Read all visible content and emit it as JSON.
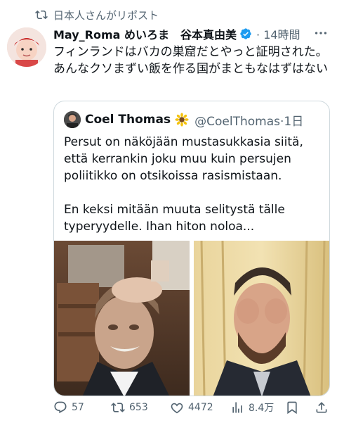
{
  "repost": {
    "label": "日本人さんがリポスト"
  },
  "post": {
    "author_name": "May_Roma めいろま　谷本真由美",
    "time": "14時間",
    "text": "フィンランドはバカの巣窟だとやっと証明された。あんなクソまずい飯を作る国がまともなはずはない"
  },
  "quote": {
    "author_name": "Coel Thomas",
    "handle": "@CoelThomas",
    "time": "1日",
    "paragraph1": "Persut on näköjään mustasukkasia siitä, että kerrankin joku muu kuin persujen poliitikko on otsikoissa rasismistaan.",
    "paragraph2": "En keksi mitään muuta selitystä tälle typeryydelle. Ihan hiton noloa..."
  },
  "actions": {
    "replies": "57",
    "reposts": "653",
    "likes": "4472",
    "views": "8.4万"
  },
  "colors": {
    "text": "#0f1419",
    "secondary": "#536471",
    "verified": "#1d9bf0",
    "border": "#cfd9de"
  },
  "icons": [
    "repost-icon",
    "verified-icon",
    "more-icon",
    "sunflower-icon",
    "reply-icon",
    "like-icon",
    "views-icon",
    "bookmark-icon",
    "share-icon"
  ]
}
